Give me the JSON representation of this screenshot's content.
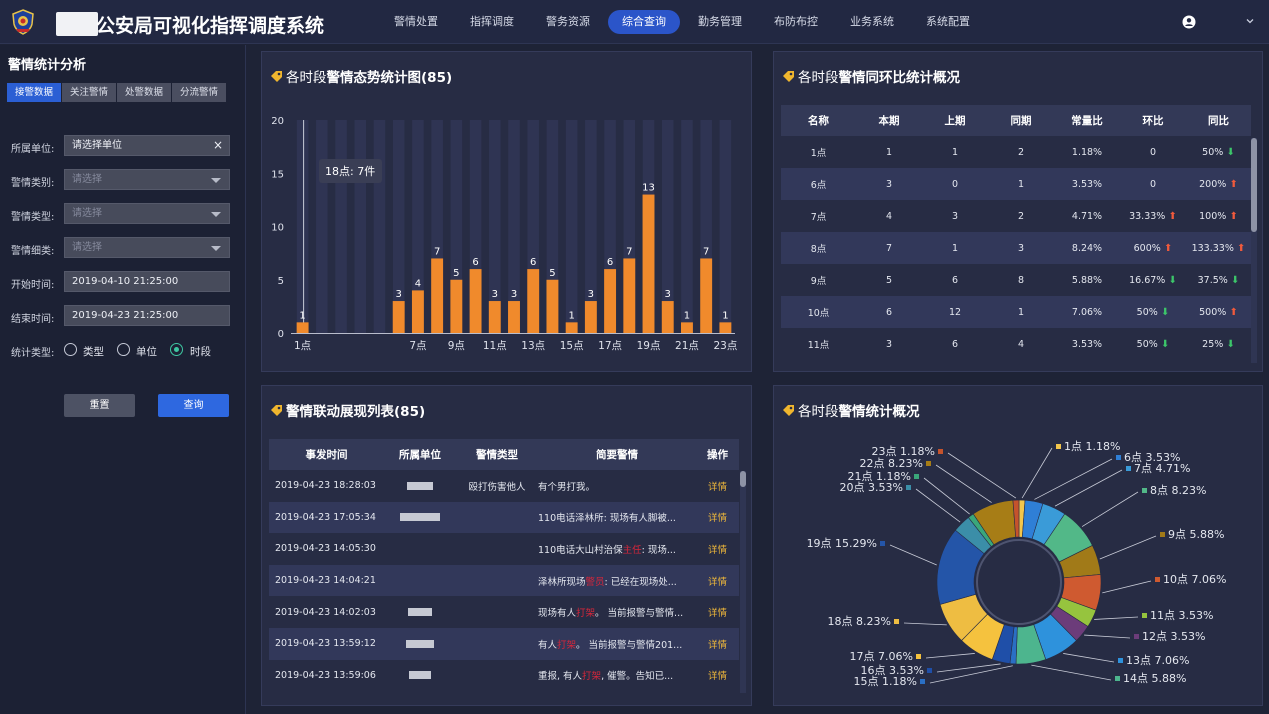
{
  "header": {
    "title": "公安局可视化指挥调度系统",
    "nav": [
      "警情处置",
      "指挥调度",
      "警务资源",
      "综合查询",
      "勤务管理",
      "布防布控",
      "业务系统",
      "系统配置"
    ],
    "active_nav": 3
  },
  "sidebar": {
    "title": "警情统计分析",
    "tabs": [
      "接警数据",
      "关注警情",
      "处警数据",
      "分流警情"
    ],
    "active_tab": 0,
    "fields": {
      "unit": {
        "label": "所属单位:",
        "value": "请选择单位"
      },
      "category": {
        "label": "警情类别:",
        "placeholder": "请选择"
      },
      "type": {
        "label": "警情类型:",
        "placeholder": "请选择"
      },
      "subtype": {
        "label": "警情细类:",
        "placeholder": "请选择"
      },
      "start": {
        "label": "开始时间:",
        "value": "2019-04-10 21:25:00"
      },
      "end": {
        "label": "结束时间:",
        "value": "2019-04-23 21:25:00"
      },
      "stat": {
        "label": "统计类型:",
        "options": [
          "类型",
          "单位",
          "时段"
        ],
        "selected": 2
      }
    },
    "reset_label": "重置",
    "query_label": "查询"
  },
  "trend_panel": {
    "title_prefix": "各时段",
    "title_bold": "警情态势统计图(85)",
    "tooltip": "18点: 7件"
  },
  "yoy_panel": {
    "title_prefix": "各时段",
    "title_bold": "警情同环比统计概况",
    "columns": [
      "名称",
      "本期",
      "上期",
      "同期",
      "常量比",
      "环比",
      "同比"
    ],
    "rows": [
      {
        "name": "1点",
        "cur": "1",
        "prev": "1",
        "same": "2",
        "ratio": "1.18%",
        "mom": "0",
        "mom_dir": "",
        "yoy": "50%",
        "yoy_dir": "down"
      },
      {
        "name": "6点",
        "cur": "3",
        "prev": "0",
        "same": "1",
        "ratio": "3.53%",
        "mom": "0",
        "mom_dir": "",
        "yoy": "200%",
        "yoy_dir": "up"
      },
      {
        "name": "7点",
        "cur": "4",
        "prev": "3",
        "same": "2",
        "ratio": "4.71%",
        "mom": "33.33%",
        "mom_dir": "up",
        "yoy": "100%",
        "yoy_dir": "up"
      },
      {
        "name": "8点",
        "cur": "7",
        "prev": "1",
        "same": "3",
        "ratio": "8.24%",
        "mom": "600%",
        "mom_dir": "up",
        "yoy": "133.33%",
        "yoy_dir": "up"
      },
      {
        "name": "9点",
        "cur": "5",
        "prev": "6",
        "same": "8",
        "ratio": "5.88%",
        "mom": "16.67%",
        "mom_dir": "down",
        "yoy": "37.5%",
        "yoy_dir": "down"
      },
      {
        "name": "10点",
        "cur": "6",
        "prev": "12",
        "same": "1",
        "ratio": "7.06%",
        "mom": "50%",
        "mom_dir": "down",
        "yoy": "500%",
        "yoy_dir": "up"
      },
      {
        "name": "11点",
        "cur": "3",
        "prev": "6",
        "same": "4",
        "ratio": "3.53%",
        "mom": "50%",
        "mom_dir": "down",
        "yoy": "25%",
        "yoy_dir": "down"
      }
    ]
  },
  "list_panel": {
    "title_bold": "警情联动展现列表(85)",
    "columns": [
      "事发时间",
      "所属单位",
      "警情类型",
      "简要警情",
      "操作"
    ],
    "rows": [
      {
        "time": "2019-04-23 18:28:03",
        "type": "殴打伤害他人",
        "summary": [
          "有个男打我。"
        ],
        "action": "详情"
      },
      {
        "time": "2019-04-23 17:05:34",
        "type": "",
        "summary": [
          "110电话泽林所: 现场有人脚被..."
        ],
        "action": "详情"
      },
      {
        "time": "2019-04-23 14:05:30",
        "type": "",
        "summary": [
          "110电话大山村治保",
          "主任",
          ": 现场..."
        ],
        "action": "详情"
      },
      {
        "time": "2019-04-23 14:04:21",
        "type": "",
        "summary": [
          "泽林所现场",
          "警员",
          ": 已经在现场处..."
        ],
        "action": "详情"
      },
      {
        "time": "2019-04-23 14:02:03",
        "type": "",
        "summary": [
          "现场有人",
          "打架",
          "。 当前报警与警情..."
        ],
        "action": "详情"
      },
      {
        "time": "2019-04-23 13:59:12",
        "type": "",
        "summary": [
          "有人",
          "打架",
          "。 当前报警与警情201..."
        ],
        "action": "详情"
      },
      {
        "time": "2019-04-23 13:59:06",
        "type": "",
        "summary": [
          "重报, 有人",
          "打架",
          ", 催警。告知已..."
        ],
        "action": "详情"
      }
    ]
  },
  "pie_panel": {
    "title_prefix": "各时段",
    "title_bold": "警情统计概况"
  },
  "chart_data": [
    {
      "type": "bar",
      "categories": [
        "1点",
        "2点",
        "3点",
        "4点",
        "5点",
        "6点",
        "7点",
        "8点",
        "9点",
        "10点",
        "11点",
        "12点",
        "13点",
        "14点",
        "15点",
        "16点",
        "17点",
        "18点",
        "19点",
        "20点",
        "21点",
        "22点",
        "23点"
      ],
      "values": [
        1,
        null,
        null,
        null,
        null,
        3,
        4,
        7,
        5,
        6,
        3,
        3,
        6,
        5,
        1,
        3,
        6,
        7,
        13,
        3,
        1,
        7,
        1
      ],
      "x_tick_labels": [
        "1点",
        "7点",
        "9点",
        "11点",
        "13点",
        "15点",
        "17点",
        "19点",
        "21点",
        "23点"
      ],
      "ylim": [
        0,
        20
      ],
      "y_ticks": [
        0,
        5,
        10,
        15,
        20
      ],
      "bar_color": "#f08a2c"
    },
    {
      "type": "pie",
      "slices": [
        {
          "label": "1点",
          "pct": "1.18%",
          "value": 1,
          "color": "#f3c64c"
        },
        {
          "label": "6点",
          "pct": "3.53%",
          "value": 3,
          "color": "#2f7fd6"
        },
        {
          "label": "7点",
          "pct": "4.71%",
          "value": 4,
          "color": "#3a9bd8"
        },
        {
          "label": "8点",
          "pct": "8.23%",
          "value": 7,
          "color": "#52b888"
        },
        {
          "label": "9点",
          "pct": "5.88%",
          "value": 5,
          "color": "#a17a18"
        },
        {
          "label": "10点",
          "pct": "7.06%",
          "value": 6,
          "color": "#cf5a30"
        },
        {
          "label": "11点",
          "pct": "3.53%",
          "value": 3,
          "color": "#96c43e"
        },
        {
          "label": "12点",
          "pct": "3.53%",
          "value": 3,
          "color": "#6c3c7a"
        },
        {
          "label": "13点",
          "pct": "7.06%",
          "value": 6,
          "color": "#2e92dc"
        },
        {
          "label": "14点",
          "pct": "5.88%",
          "value": 5,
          "color": "#4db58e"
        },
        {
          "label": "15点",
          "pct": "1.18%",
          "value": 1,
          "color": "#2a6fc4"
        },
        {
          "label": "16点",
          "pct": "3.53%",
          "value": 3,
          "color": "#1f4fa8"
        },
        {
          "label": "17点",
          "pct": "7.06%",
          "value": 6,
          "color": "#f5c23e"
        },
        {
          "label": "18点",
          "pct": "8.23%",
          "value": 7,
          "color": "#eebd42"
        },
        {
          "label": "19点",
          "pct": "15.29%",
          "value": 13,
          "color": "#2455a8"
        },
        {
          "label": "20点",
          "pct": "3.53%",
          "value": 3,
          "color": "#3b8ea8"
        },
        {
          "label": "21点",
          "pct": "1.18%",
          "value": 1,
          "color": "#3aa77a"
        },
        {
          "label": "22点",
          "pct": "8.23%",
          "value": 7,
          "color": "#a77d16"
        },
        {
          "label": "23点",
          "pct": "1.18%",
          "value": 1,
          "color": "#c5532c"
        }
      ]
    }
  ]
}
